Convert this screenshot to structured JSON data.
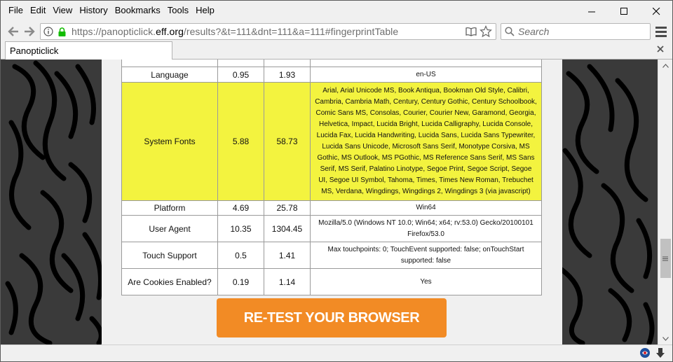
{
  "menu": [
    "File",
    "Edit",
    "View",
    "History",
    "Bookmarks",
    "Tools",
    "Help"
  ],
  "url": {
    "prefix": "https://panopticlick.",
    "host": "eff.org",
    "suffix": "/results?&t=111&dnt=111&a=111#fingerprintTable"
  },
  "search": {
    "placeholder": "Search"
  },
  "tab": {
    "title": "Panopticlick"
  },
  "table": {
    "rows": [
      {
        "name": "Language",
        "bits": "0.95",
        "one_in_x": "1.93",
        "value": "en-US",
        "highlight": false
      },
      {
        "name": "System Fonts",
        "bits": "5.88",
        "one_in_x": "58.73",
        "value": "Arial, Arial Unicode MS, Book Antiqua, Bookman Old Style, Calibri, Cambria, Cambria Math, Century, Century Gothic, Century Schoolbook, Comic Sans MS, Consolas, Courier, Courier New, Garamond, Georgia, Helvetica, Impact, Lucida Bright, Lucida Calligraphy, Lucida Console, Lucida Fax, Lucida Handwriting, Lucida Sans, Lucida Sans Typewriter, Lucida Sans Unicode, Microsoft Sans Serif, Monotype Corsiva, MS Gothic, MS Outlook, MS PGothic, MS Reference Sans Serif, MS Sans Serif, MS Serif, Palatino Linotype, Segoe Print, Segoe Script, Segoe UI, Segoe UI Symbol, Tahoma, Times, Times New Roman, Trebuchet MS, Verdana, Wingdings, Wingdings 2, Wingdings 3 (via javascript)",
        "highlight": true
      },
      {
        "name": "Platform",
        "bits": "4.69",
        "one_in_x": "25.78",
        "value": "Win64",
        "highlight": false
      },
      {
        "name": "User Agent",
        "bits": "10.35",
        "one_in_x": "1304.45",
        "value": "Mozilla/5.0 (Windows NT 10.0; Win64; x64; rv:53.0) Gecko/20100101 Firefox/53.0",
        "highlight": false
      },
      {
        "name": "Touch Support",
        "bits": "0.5",
        "one_in_x": "1.41",
        "value": "Max touchpoints: 0; TouchEvent supported: false; onTouchStart supported: false",
        "highlight": false
      },
      {
        "name": "Are Cookies Enabled?",
        "bits": "0.19",
        "one_in_x": "1.14",
        "value": "Yes",
        "highlight": false
      }
    ]
  },
  "retest_button": "RE-TEST YOUR BROWSER",
  "colors": {
    "highlight": "#f3f33f",
    "button": "#f28b25",
    "background": "#3a3a3a"
  }
}
